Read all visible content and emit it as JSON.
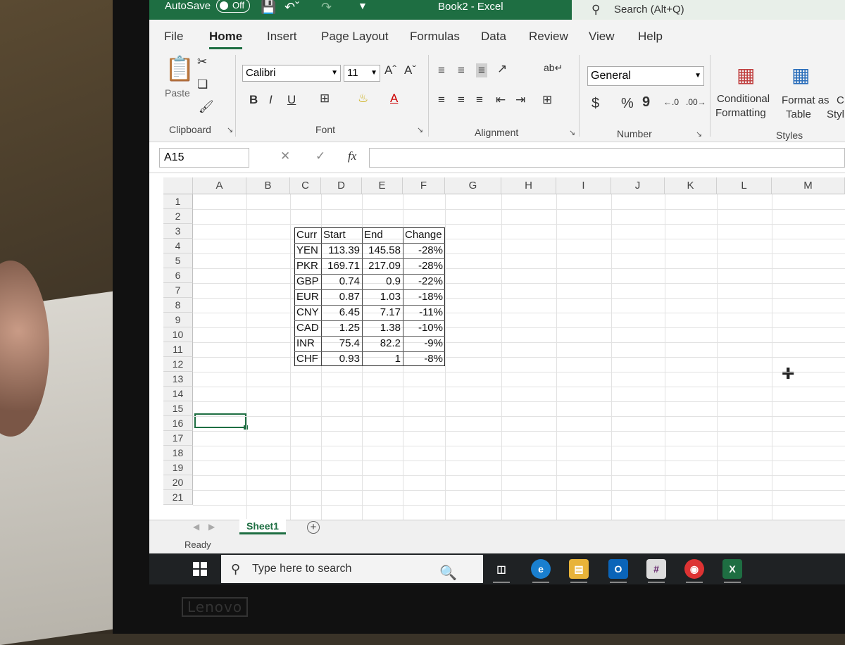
{
  "title_bar": {
    "autosave_label": "AutoSave",
    "autosave_state": "Off",
    "document": "Book2",
    "separator": "-",
    "app": "Excel",
    "search_placeholder": "Search (Alt+Q)"
  },
  "menu_tabs": [
    "File",
    "Home",
    "Insert",
    "Page Layout",
    "Formulas",
    "Data",
    "Review",
    "View",
    "Help"
  ],
  "active_tab": "Home",
  "ribbon": {
    "clipboard": {
      "paste_label": "Paste",
      "group_label": "Clipboard"
    },
    "font": {
      "font_name": "Calibri",
      "font_size": "11",
      "bold": "B",
      "italic": "I",
      "underline": "U",
      "group_label": "Font"
    },
    "alignment": {
      "group_label": "Alignment"
    },
    "number": {
      "format": "General",
      "currency": "$",
      "percent": "%",
      "comma": "9",
      "group_label": "Number"
    },
    "styles": {
      "conditional_line1": "Conditional",
      "conditional_line2": "Formatting",
      "format_table_line1": "Format as",
      "format_table_line2": "Table",
      "cell_styles_line1": "C",
      "cell_styles_line2": "Styl",
      "group_label": "Styles"
    }
  },
  "formula_bar": {
    "name_box": "A15",
    "fx": "fx",
    "formula": ""
  },
  "columns": [
    "A",
    "B",
    "C",
    "D",
    "E",
    "F",
    "G",
    "H",
    "I",
    "J",
    "K",
    "L",
    "M"
  ],
  "rows": [
    "1",
    "2",
    "3",
    "4",
    "5",
    "6",
    "7",
    "8",
    "9",
    "10",
    "11",
    "12",
    "13",
    "14",
    "15",
    "16",
    "17",
    "18",
    "19",
    "20",
    "21"
  ],
  "table": {
    "headers": [
      "Curr",
      "Start",
      "End",
      "Change"
    ],
    "rows": [
      [
        "YEN",
        "113.39",
        "145.58",
        "-28%"
      ],
      [
        "PKR",
        "169.71",
        "217.09",
        "-28%"
      ],
      [
        "GBP",
        "0.74",
        "0.9",
        "-22%"
      ],
      [
        "EUR",
        "0.87",
        "1.03",
        "-18%"
      ],
      [
        "CNY",
        "6.45",
        "7.17",
        "-11%"
      ],
      [
        "CAD",
        "1.25",
        "1.38",
        "-10%"
      ],
      [
        "INR",
        "75.4",
        "82.2",
        "-9%"
      ],
      [
        "CHF",
        "0.93",
        "1",
        "-8%"
      ]
    ]
  },
  "selected_cell": "A15",
  "sheet_tabs": [
    "Sheet1"
  ],
  "status": "Ready",
  "taskbar": {
    "search_placeholder": "Type here to search"
  },
  "device_brand": "Lenovo",
  "colors": {
    "excel_green": "#1e6e42",
    "taskbar": "#1f2224"
  }
}
